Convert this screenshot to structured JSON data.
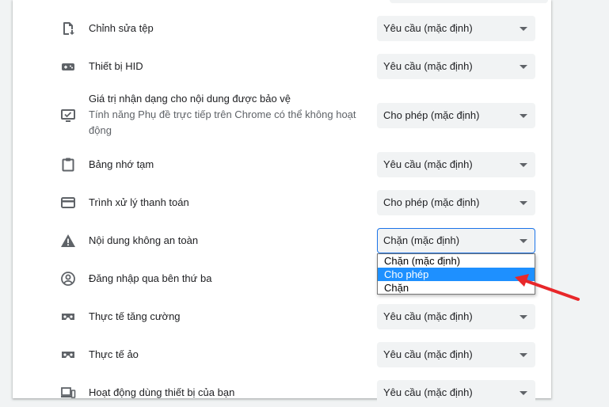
{
  "permissions": [
    {
      "label": "Chỉnh sửa tệp",
      "value": "Yêu cầu (mặc định)",
      "icon": "file-edit-icon"
    },
    {
      "label": "Thiết bị HID",
      "value": "Yêu cầu (mặc định)",
      "icon": "gamepad-icon"
    },
    {
      "label": "Giá trị nhận dạng cho nội dung được bảo vệ",
      "sublabel": "Tính năng Phụ đề trực tiếp trên Chrome có thể không hoạt động",
      "value": "Cho phép (mặc định)",
      "icon": "monitor-check-icon"
    },
    {
      "label": "Bảng nhớ tạm",
      "value": "Yêu cầu (mặc định)",
      "icon": "clipboard-icon"
    },
    {
      "label": "Trình xử lý thanh toán",
      "value": "Cho phép (mặc định)",
      "icon": "credit-card-icon"
    },
    {
      "label": "Nội dung không an toàn",
      "value": "Chặn (mặc định)",
      "icon": "warning-icon"
    },
    {
      "label": "Đăng nhập qua bên thứ ba",
      "icon": "account-circle-icon"
    },
    {
      "label": "Thực tế tăng cường",
      "value": "Yêu cầu (mặc định)",
      "icon": "vr-headset-icon"
    },
    {
      "label": "Thực tế ảo",
      "value": "Yêu cầu (mặc định)",
      "icon": "vr-headset-icon"
    },
    {
      "label": "Hoạt động dùng thiết bị của bạn",
      "value": "Yêu cầu (mặc định)",
      "icon": "devices-icon"
    }
  ],
  "dropdown": {
    "options": [
      "Chặn (mặc định)",
      "Cho phép",
      "Chặn"
    ],
    "highlighted": "Cho phép"
  },
  "colors": {
    "accent": "#1a73e8",
    "highlight": "#1e90ff",
    "arrow": "#e8272a"
  }
}
